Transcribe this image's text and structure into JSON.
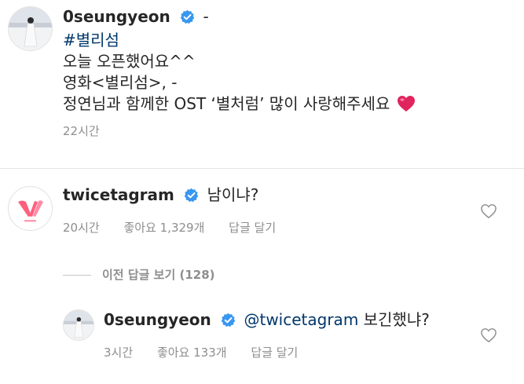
{
  "caption": {
    "username": "0seungyeon",
    "dash": "-",
    "hashtag": "#별리섬",
    "line2": "오늘 오픈했어요^^",
    "line3": "영화<별리섬>, -",
    "line4": "정연님과 함께한 OST ‘별처럼’ 많이 사랑해주세요",
    "time": "22시간"
  },
  "comment": {
    "username": "twicetagram",
    "text": "남이냐?",
    "time": "20시간",
    "likes": "좋아요 1,329개",
    "reply_label": "답글 달기"
  },
  "view_replies": {
    "label": "이전 답글 보기 (128)"
  },
  "reply": {
    "username": "0seungyeon",
    "mention": "@twicetagram",
    "text": "보긴했냐?",
    "time": "3시간",
    "likes": "좋아요 133개",
    "reply_label": "답글 달기"
  },
  "colors": {
    "verified": "#3897f0",
    "heart_emoji": "#e0245e",
    "twice_logo": "#ff5f7e",
    "meta_text": "#8e8e8e",
    "hashtag": "#00376b"
  }
}
